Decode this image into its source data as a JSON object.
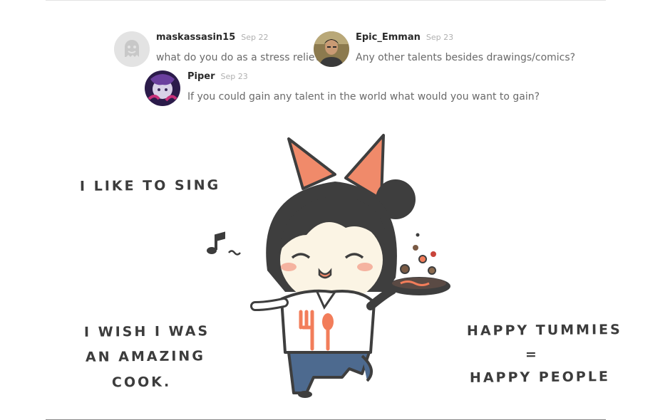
{
  "comments": [
    {
      "username": "maskassasin15",
      "date": "Sep 22",
      "text": "what do you do as a stress reliever",
      "avatar": "ghost-avatar-icon"
    },
    {
      "username": "Epic_Emman",
      "date": "Sep 23",
      "text": "Any other talents besides drawings/comics?",
      "avatar": "photo-avatar"
    },
    {
      "username": "Piper",
      "date": "Sep 23",
      "text": "If you could gain any talent in the world what would you want to gain?",
      "avatar": "art-avatar"
    }
  ],
  "comic": {
    "caption_sing": "I LIKE TO SING",
    "caption_cook_1": "I WISH I WAS",
    "caption_cook_2": "AN AMAZING",
    "caption_cook_3": "COOK.",
    "caption_happy_1": "HAPPY TUMMIES",
    "caption_happy_2": "=",
    "caption_happy_3": "HAPPY PEOPLE"
  },
  "colors": {
    "bow": "#f08a6a",
    "hair": "#3e3e3e",
    "pants": "#4d6a8f",
    "accent": "#f27d5a"
  }
}
